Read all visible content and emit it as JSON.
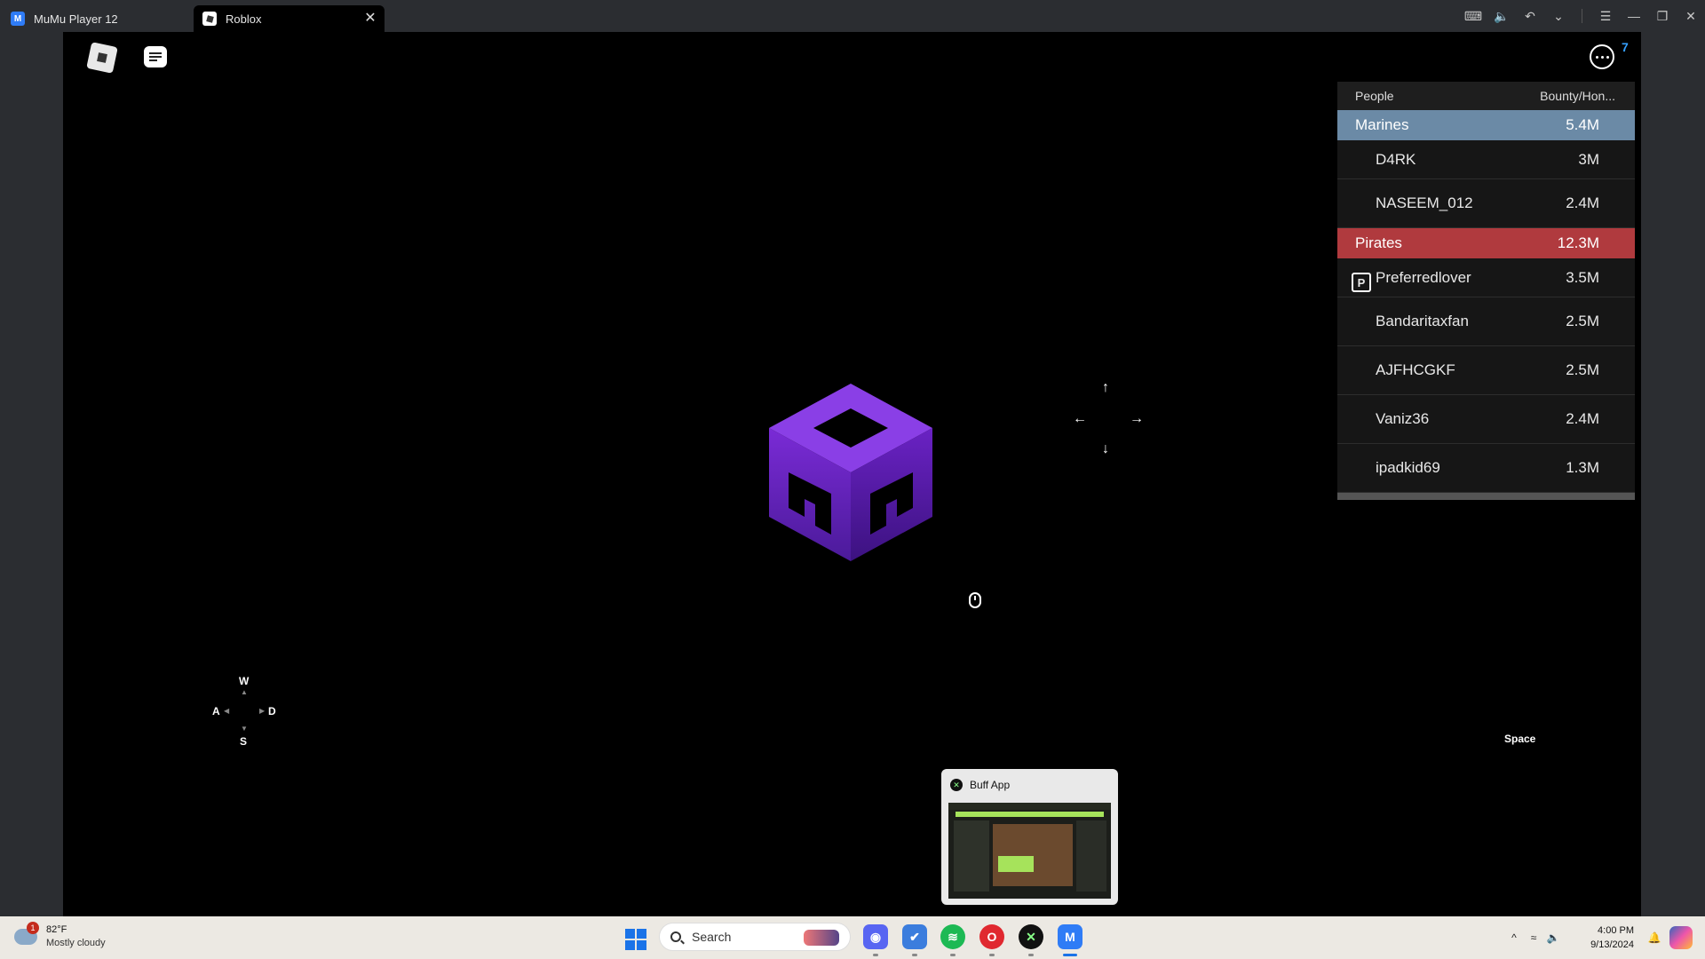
{
  "titlebar": {
    "tabs": [
      {
        "label": "MuMu Player 12",
        "icon": "mumu-icon"
      },
      {
        "label": "Roblox",
        "icon": "roblox-icon",
        "active": true
      }
    ],
    "close_glyph": "✕"
  },
  "game": {
    "notification_count": "7",
    "leaderboard": {
      "header": {
        "people": "People",
        "stat": "Bounty/Hon..."
      },
      "teams": [
        {
          "name": "Marines",
          "total": "5.4M",
          "color": "#6b8aa6",
          "players": [
            {
              "name": "D4RK",
              "value": "3M"
            },
            {
              "name": "NASEEM_012",
              "value": "2.4M"
            }
          ]
        },
        {
          "name": "Pirates",
          "total": "12.3M",
          "color": "#b03a3e",
          "players": [
            {
              "name": "Preferredlover",
              "value": "3.5M",
              "badge": "premium-icon"
            },
            {
              "name": "Bandaritaxfan",
              "value": "2.5M"
            },
            {
              "name": "AJFHCGKF",
              "value": "2.5M"
            },
            {
              "name": "Vaniz36",
              "value": "2.4M"
            },
            {
              "name": "ipadkid69",
              "value": "1.3M"
            }
          ]
        }
      ]
    },
    "controls": {
      "w": "W",
      "a": "A",
      "s": "S",
      "d": "D",
      "space": "Space",
      "arrow_up": "↑",
      "arrow_down": "↓",
      "arrow_left": "←",
      "arrow_right": "→"
    }
  },
  "popup": {
    "title": "Buff App"
  },
  "taskbar": {
    "weather": {
      "temp": "82°F",
      "desc": "Mostly cloudy",
      "badge": "1"
    },
    "search_placeholder": "Search",
    "clock": {
      "time": "4:00 PM",
      "date": "9/13/2024"
    },
    "apps": [
      "discord-icon",
      "vpn-icon",
      "spotify-icon",
      "opera-icon",
      "buff-icon",
      "mumu-icon"
    ]
  }
}
